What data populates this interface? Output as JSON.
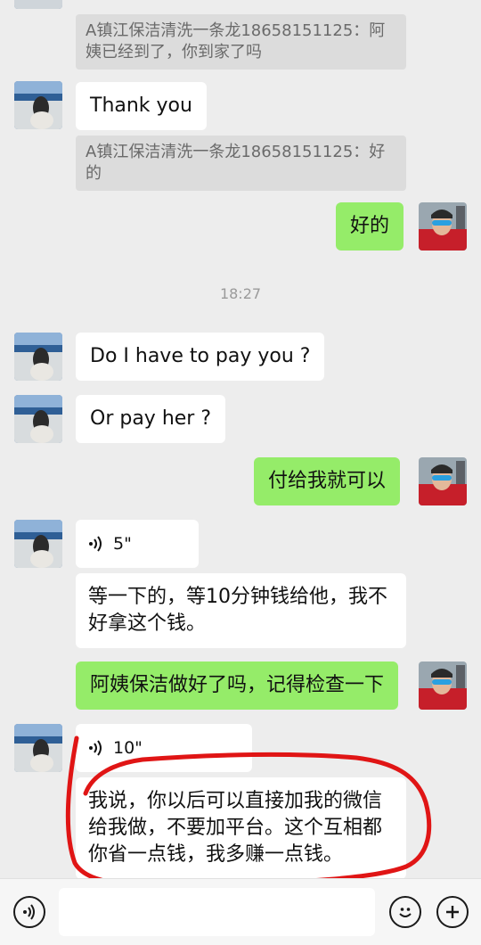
{
  "messages": {
    "quote1": "A镇江保洁清洗一条龙18658151125：阿姨已经到了，你到家了吗",
    "thank_you": "Thank you",
    "quote2": "A镇江保洁清洗一条龙18658151125：好的",
    "ok_reply": "好的",
    "timestamp": "18:27",
    "pay_you": "Do I have to pay you ?",
    "pay_her": "Or pay her ?",
    "pay_me_reply": "付给我就可以",
    "voice1_duration": "5\"",
    "wait_msg": "等一下的，等10分钟钱给他，我不好拿这个钱。",
    "check_reply": "阿姨保洁做好了吗，记得检查一下",
    "voice2_duration": "10\"",
    "direct_msg": "我说，你以后可以直接加我的微信给我做，不要加平台。这个互相都你省一点钱，我多赚一点钱。"
  },
  "input_bar": {
    "voice_icon": "voice-icon",
    "emoji_icon": "emoji-icon",
    "plus_icon": "plus-icon"
  },
  "colors": {
    "outgoing_bubble": "#95ec69",
    "incoming_bubble": "#ffffff",
    "background": "#ededed",
    "annotation": "#e01515"
  }
}
